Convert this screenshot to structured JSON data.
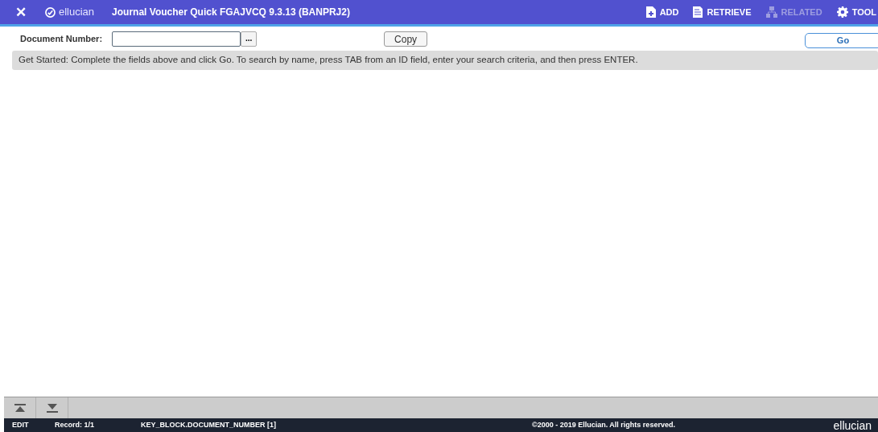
{
  "header": {
    "close": "✕",
    "brand": "ellucian",
    "title": "Journal Voucher Quick FGAJVCQ 9.3.13 (BANPRJ2)",
    "actions": [
      {
        "label": "ADD",
        "kind": "add",
        "disabled": false
      },
      {
        "label": "RETRIEVE",
        "kind": "retrieve",
        "disabled": false
      },
      {
        "label": "RELATED",
        "kind": "related",
        "disabled": true
      },
      {
        "label": "TOOL",
        "kind": "tools",
        "disabled": false
      }
    ]
  },
  "key_block": {
    "label": "Document Number:",
    "lookup": "...",
    "copy": "Copy",
    "go": "Go"
  },
  "notice": "Get Started: Complete the fields above and click Go. To search by name, press TAB from an ID field, enter your search criteria, and then press ENTER.",
  "status_bar": {
    "mode": "EDIT",
    "record": "Record: 1/1",
    "field": "KEY_BLOCK.DOCUMENT_NUMBER [1]",
    "copyright": "©2000 - 2019 Ellucian. All rights reserved.",
    "logo": "ellucian"
  }
}
